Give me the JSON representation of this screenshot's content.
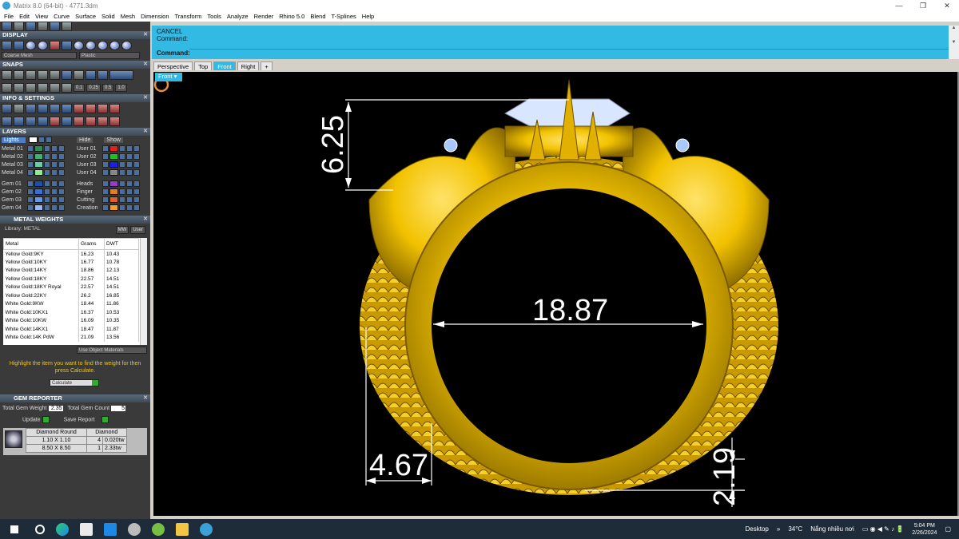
{
  "window": {
    "title": "Matrix 8.0 (64-bit) - 4771.3dm",
    "controls": [
      "—",
      "❐",
      "✕"
    ]
  },
  "menu": [
    "File",
    "Edit",
    "View",
    "Curve",
    "Surface",
    "Solid",
    "Mesh",
    "Dimension",
    "Transform",
    "Tools",
    "Analyze",
    "Render",
    "Rhino 5.0",
    "Blend",
    "T-Splines",
    "Help"
  ],
  "panels": {
    "display": {
      "title": "DISPLAY",
      "mesh_select": "Coarse Mesh",
      "material_select": "Plastic"
    },
    "snaps": {
      "title": "SNAPS",
      "values": [
        "0.1",
        "0.25",
        "0.5",
        "1.0"
      ]
    },
    "info": {
      "title": "INFO & SETTINGS"
    },
    "layers": {
      "title": "LAYERS",
      "lights": "Lights",
      "hide": "Hide",
      "show": "Show",
      "left": [
        {
          "name": "Metal 01",
          "color": "#2e8b57"
        },
        {
          "name": "Metal 02",
          "color": "#3cb371"
        },
        {
          "name": "Metal 03",
          "color": "#66cdaa"
        },
        {
          "name": "Metal 04",
          "color": "#90ee90"
        },
        {
          "name": "Gem 01",
          "color": "#1f4fa8"
        },
        {
          "name": "Gem 02",
          "color": "#3a6fd8"
        },
        {
          "name": "Gem 03",
          "color": "#6a96e8"
        },
        {
          "name": "Gem 04",
          "color": "#9ab8f0"
        }
      ],
      "right": [
        {
          "name": "User 01",
          "color": "#e02020"
        },
        {
          "name": "User 02",
          "color": "#20c020"
        },
        {
          "name": "User 03",
          "color": "#2020e0"
        },
        {
          "name": "User 04",
          "color": "#888888"
        },
        {
          "name": "Heads",
          "color": "#9040c0"
        },
        {
          "name": "Finger",
          "color": "#e08020"
        },
        {
          "name": "Cutting",
          "color": "#e06020"
        },
        {
          "name": "Creation",
          "color": "#f0a030"
        }
      ]
    },
    "metal_weights": {
      "title": "METAL WEIGHTS",
      "library": "Library: METAL",
      "btn_mw": "MW",
      "btn_user": "User",
      "headers": [
        "Metal",
        "Grams",
        "DWT"
      ],
      "rows": [
        [
          "Yellow Gold:9KY",
          "16.23",
          "10.43"
        ],
        [
          "Yellow Gold:10KY",
          "16.77",
          "10.78"
        ],
        [
          "Yellow Gold:14KY",
          "18.86",
          "12.13"
        ],
        [
          "Yellow Gold:18KY",
          "22.57",
          "14.51"
        ],
        [
          "Yellow Gold:18KY Royal",
          "22.57",
          "14.51"
        ],
        [
          "Yellow Gold:22KY",
          "26.2",
          "16.85"
        ],
        [
          "White Gold:9KW",
          "18.44",
          "11.86"
        ],
        [
          "White Gold:10KX1",
          "16.37",
          "10.53"
        ],
        [
          "White Gold:10KW",
          "16.09",
          "10.35"
        ],
        [
          "White Gold:14KX1",
          "18.47",
          "11.87"
        ],
        [
          "White Gold:14K PdW",
          "21.09",
          "13.56"
        ]
      ],
      "use_object_materials": "Use Object Materials",
      "hint": "Highlight the item you want to find the weight for then press Calculate.",
      "calculate": "Calculate"
    },
    "gem_reporter": {
      "title": "GEM REPORTER",
      "total_weight_label": "Total Gem Weight",
      "total_weight": "2.35",
      "total_count_label": "Total Gem Count",
      "total_count": "5",
      "update": "Update",
      "save_report": "Save Report",
      "headers": [
        "Diamond Round",
        "Diamond"
      ],
      "rows": [
        [
          "1.10 X 1.10",
          "4",
          "0.020tw"
        ],
        [
          "8.50 X 8.50",
          "1",
          "2.33tw"
        ]
      ]
    }
  },
  "command": {
    "line1": "CANCEL",
    "line2": "Command:",
    "prompt": "Command:"
  },
  "viewport": {
    "tabs": [
      "Perspective",
      "Top",
      "Front",
      "Right"
    ],
    "active_tab": "Front",
    "label": "Front",
    "dimensions": [
      "6.25",
      "18.87",
      "4.67",
      "2.19"
    ],
    "colors": {
      "gold": "#f2c200",
      "gold_dark": "#8a6a00",
      "background": "#000000"
    }
  },
  "taskbar": {
    "desktop": "Desktop",
    "weather": "34°C",
    "weather_text": "Nắng nhiều nơi",
    "time": "5:04 PM",
    "date": "2/26/2024"
  }
}
